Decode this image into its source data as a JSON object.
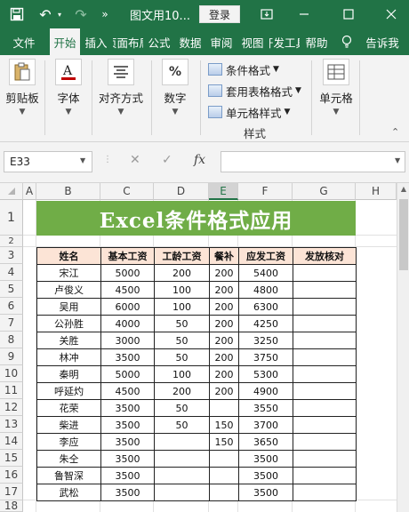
{
  "titlebar": {
    "save_icon": "save-icon",
    "undo_icon": "undo-icon",
    "redo_icon": "redo-icon",
    "more_icon": "more-icon",
    "doc_title": "图文用10...",
    "login_label": "登录",
    "ribbon_display_icon": "ribbon-display-icon",
    "min_icon": "minimize-icon",
    "max_icon": "maximize-icon",
    "close_icon": "close-icon"
  },
  "tabs": [
    "文件",
    "开始",
    "插入",
    "页面布局",
    "公式",
    "数据",
    "审阅",
    "视图",
    "开发工具",
    "帮助"
  ],
  "tell_me": "告诉我",
  "ribbon": {
    "clipboard": "剪贴板",
    "font": "字体",
    "alignment": "对齐方式",
    "number": "数字",
    "conditional_format": "条件格式",
    "table_format": "套用表格格式",
    "cell_style": "单元格样式",
    "styles_group": "样式",
    "cells": "单元格"
  },
  "formula_bar": {
    "name_box": "E33",
    "cancel": "✕",
    "confirm": "✓",
    "fx": "fx",
    "formula": ""
  },
  "columns": [
    "A",
    "B",
    "C",
    "D",
    "E",
    "F",
    "G",
    "H"
  ],
  "selected_column": "E",
  "rows": [
    "1",
    "2",
    "3",
    "4",
    "5",
    "6",
    "7",
    "8",
    "9",
    "10",
    "11",
    "12",
    "13",
    "14",
    "15",
    "16",
    "17",
    "18"
  ],
  "banner_title": "Excel条件格式应用",
  "table": {
    "headers": [
      "姓名",
      "基本工资",
      "工龄工资",
      "餐补",
      "应发工资",
      "发放核对"
    ],
    "rows": [
      [
        "宋江",
        "5000",
        "200",
        "200",
        "5400",
        ""
      ],
      [
        "卢俊义",
        "4500",
        "100",
        "200",
        "4800",
        ""
      ],
      [
        "吴用",
        "6000",
        "100",
        "200",
        "6300",
        ""
      ],
      [
        "公孙胜",
        "4000",
        "50",
        "200",
        "4250",
        ""
      ],
      [
        "关胜",
        "3000",
        "50",
        "200",
        "3250",
        ""
      ],
      [
        "林冲",
        "3500",
        "50",
        "200",
        "3750",
        ""
      ],
      [
        "秦明",
        "5000",
        "100",
        "200",
        "5300",
        ""
      ],
      [
        "呼延灼",
        "4500",
        "200",
        "200",
        "4900",
        ""
      ],
      [
        "花荣",
        "3500",
        "50",
        "",
        "3550",
        ""
      ],
      [
        "柴进",
        "3500",
        "50",
        "150",
        "3700",
        ""
      ],
      [
        "李应",
        "3500",
        "",
        "150",
        "3650",
        ""
      ],
      [
        "朱仝",
        "3500",
        "",
        "",
        "3500",
        ""
      ],
      [
        "鲁智深",
        "3500",
        "",
        "",
        "3500",
        ""
      ],
      [
        "武松",
        "3500",
        "",
        "",
        "3500",
        ""
      ]
    ]
  },
  "colors": {
    "accent": "#217346",
    "banner": "#70ad47",
    "header_fill": "#fce4d6"
  }
}
